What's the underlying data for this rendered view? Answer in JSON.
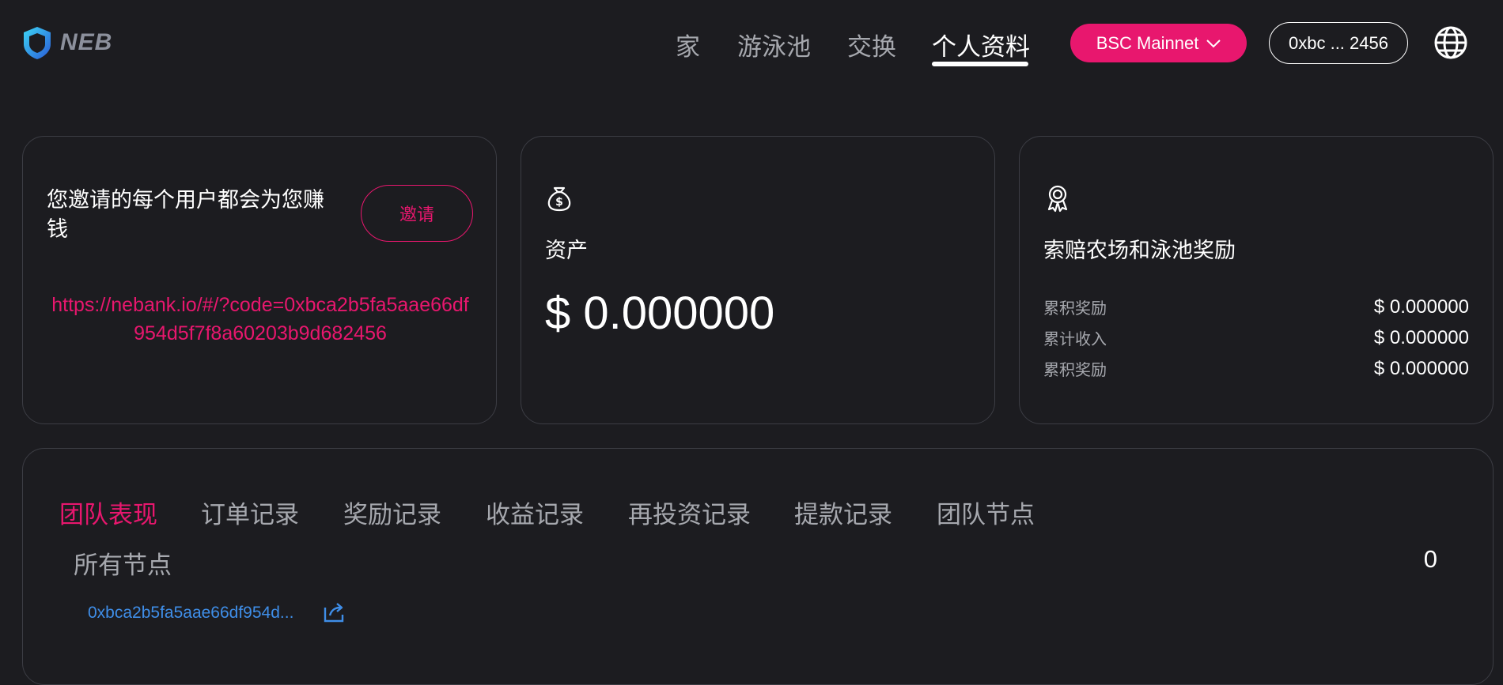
{
  "brand": {
    "name": "NEB"
  },
  "nav": {
    "items": [
      {
        "label": "家"
      },
      {
        "label": "游泳池"
      },
      {
        "label": "交换"
      },
      {
        "label": "个人资料"
      }
    ],
    "active": "个人资料"
  },
  "network": {
    "label": "BSC Mainnet"
  },
  "wallet": {
    "address_short": "0xbc ... 2456"
  },
  "invite": {
    "text": "您邀请的每个用户都会为您赚钱",
    "button": "邀请",
    "link": "https://nebank.io/#/?code=0xbca2b5fa5aae66df954d5f7f8a60203b9d682456"
  },
  "assets": {
    "title": "资产",
    "value": "$ 0.000000"
  },
  "rewards": {
    "title": "索赔农场和泳池奖励",
    "rows": [
      {
        "label": "累积奖励",
        "value": "$ 0.000000"
      },
      {
        "label": "累计收入",
        "value": "$ 0.000000"
      },
      {
        "label": "累积奖励",
        "value": "$ 0.000000"
      }
    ]
  },
  "records": {
    "tabs": [
      {
        "label": "团队表现"
      },
      {
        "label": "订单记录"
      },
      {
        "label": "奖励记录"
      },
      {
        "label": "收益记录"
      },
      {
        "label": "再投资记录"
      },
      {
        "label": "提款记录"
      },
      {
        "label": "团队节点"
      }
    ],
    "active_tab": "团队表现",
    "nodes_label": "所有节点",
    "nodes_count": "0",
    "node_address": "0xbca2b5fa5aae66df954d..."
  },
  "colors": {
    "background": "#1c1c20",
    "accent": "#e8176e",
    "link": "#3f8ee8",
    "muted": "#a6a8ae",
    "border": "#3c3d44"
  }
}
